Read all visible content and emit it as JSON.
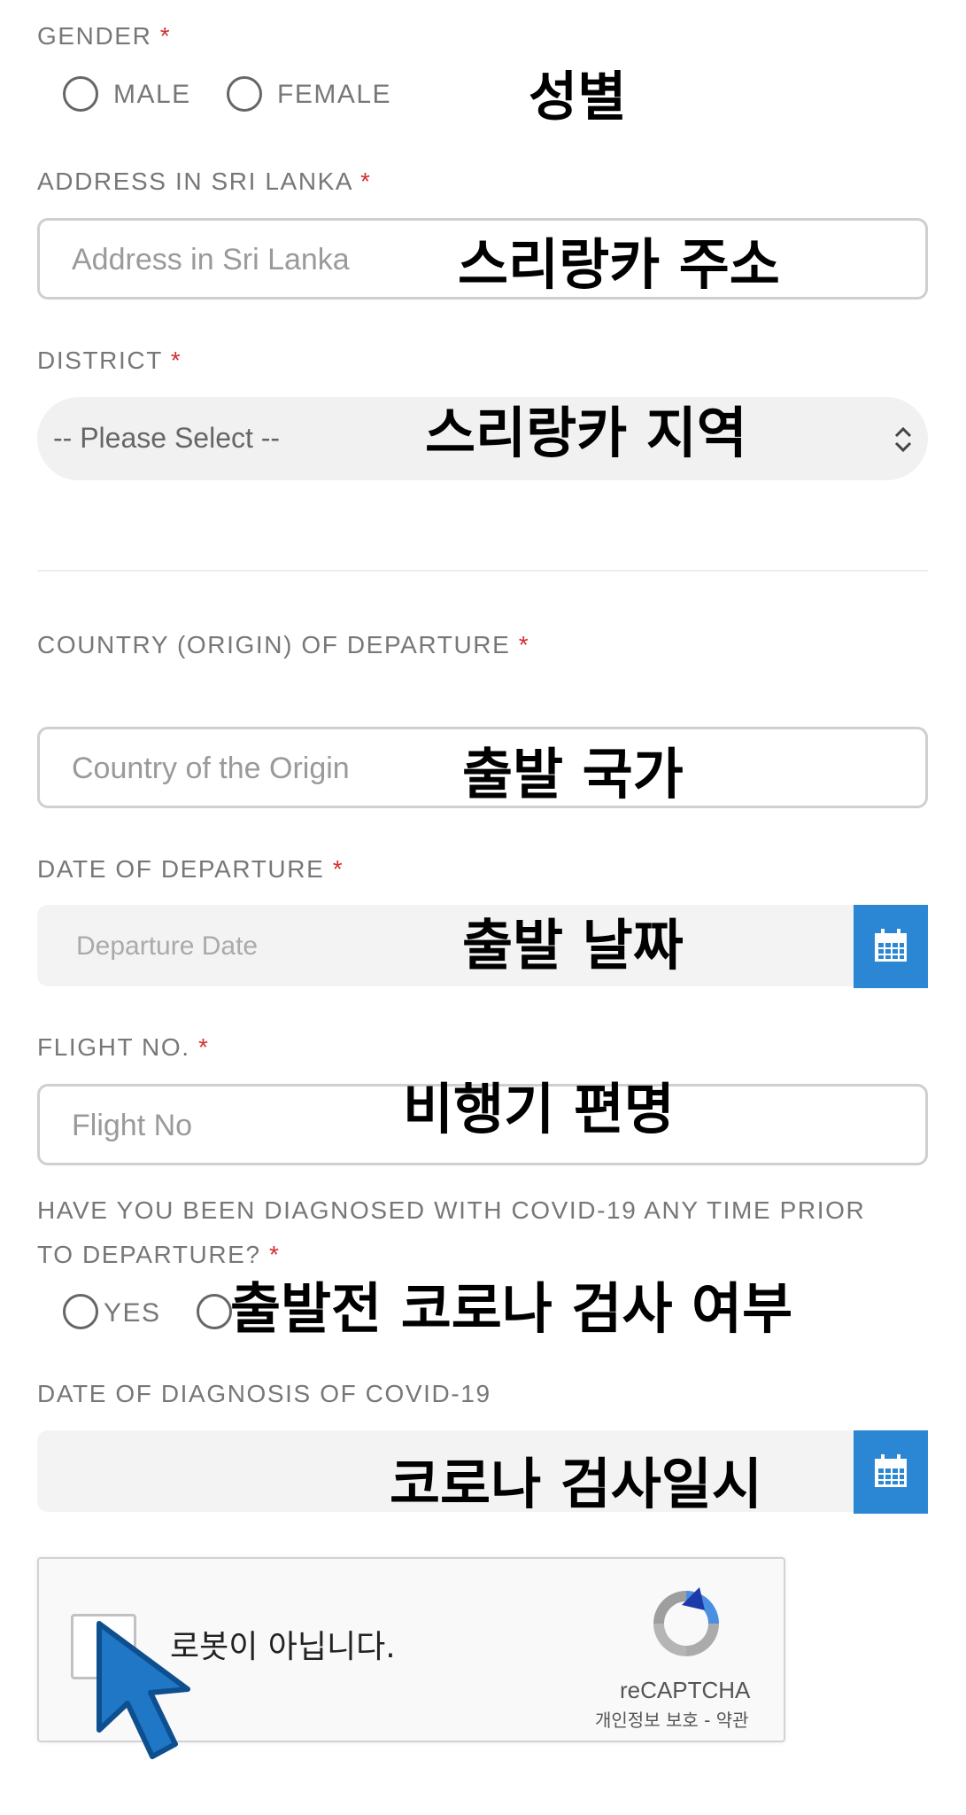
{
  "gender": {
    "label": "GENDER",
    "required_mark": "*",
    "options": [
      "MALE",
      "FEMALE"
    ],
    "annotation": "성별"
  },
  "address": {
    "label": "ADDRESS IN SRI LANKA",
    "required_mark": "*",
    "placeholder": "Address in Sri Lanka",
    "annotation": "스리랑카 주소"
  },
  "district": {
    "label": "DISTRICT",
    "required_mark": "*",
    "selected": "-- Please Select --",
    "annotation": "스리랑카 지역"
  },
  "country": {
    "label": "COUNTRY (ORIGIN) OF DEPARTURE",
    "required_mark": "*",
    "placeholder": "Country of the Origin",
    "annotation": "출발 국가"
  },
  "departure_date": {
    "label": "DATE OF DEPARTURE",
    "required_mark": "*",
    "placeholder": "Departure Date",
    "annotation": "출발 날짜"
  },
  "flight": {
    "label": "FLIGHT NO.",
    "required_mark": "*",
    "placeholder": "Flight No",
    "annotation": "비행기 편명"
  },
  "covid_question": {
    "label_line1": "HAVE YOU BEEN DIAGNOSED WITH COVID-19 ANY TIME PRIOR",
    "label_line2": "TO DEPARTURE?",
    "required_mark": "*",
    "options": [
      "YES"
    ],
    "annotation": "출발전 코로나 검사 여부"
  },
  "covid_date": {
    "label": "DATE OF DIAGNOSIS OF COVID-19",
    "annotation": "코로나 검사일시"
  },
  "recaptcha": {
    "checkbox_label": "로봇이 아닙니다.",
    "brand": "reCAPTCHA",
    "links": "개인정보 보호 - 약관"
  },
  "colors": {
    "accent": "#2b86d3",
    "required": "#d32f2f",
    "label": "#777777",
    "border": "#cfcfcf"
  },
  "icons": [
    "calendar-icon",
    "chevron-updown-icon",
    "recaptcha-logo-icon",
    "mouse-cursor-icon"
  ]
}
